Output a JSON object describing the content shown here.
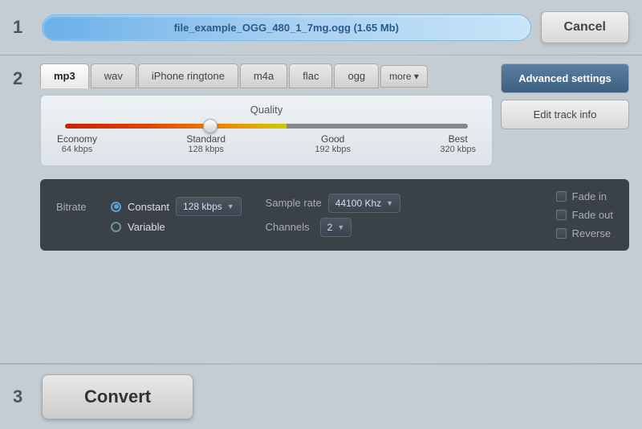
{
  "step1": {
    "number": "1",
    "file_name": "file_example_OGG_480_1_7mg.ogg (1.65 Mb)",
    "cancel_label": "Cancel"
  },
  "step2": {
    "number": "2",
    "tabs": [
      {
        "id": "mp3",
        "label": "mp3",
        "active": true
      },
      {
        "id": "wav",
        "label": "wav",
        "active": false
      },
      {
        "id": "iphone",
        "label": "iPhone ringtone",
        "active": false
      },
      {
        "id": "m4a",
        "label": "m4a",
        "active": false
      },
      {
        "id": "flac",
        "label": "flac",
        "active": false
      },
      {
        "id": "ogg",
        "label": "ogg",
        "active": false
      }
    ],
    "more_label": "more",
    "quality_title": "Quality",
    "quality_labels": [
      {
        "name": "Economy",
        "kbps": "64 kbps"
      },
      {
        "name": "Standard",
        "kbps": "128 kbps"
      },
      {
        "name": "Good",
        "kbps": "192 kbps"
      },
      {
        "name": "Best",
        "kbps": "320 kbps"
      }
    ],
    "advanced_settings_label": "Advanced settings",
    "edit_track_label": "Edit track info",
    "bitrate_label": "Bitrate",
    "constant_label": "Constant",
    "variable_label": "Variable",
    "bitrate_value": "128 kbps",
    "sample_rate_label": "Sample rate",
    "sample_rate_value": "44100 Khz",
    "channels_label": "Channels",
    "channels_value": "2",
    "fade_in_label": "Fade in",
    "fade_out_label": "Fade out",
    "reverse_label": "Reverse"
  },
  "step3": {
    "number": "3",
    "convert_label": "Convert"
  }
}
